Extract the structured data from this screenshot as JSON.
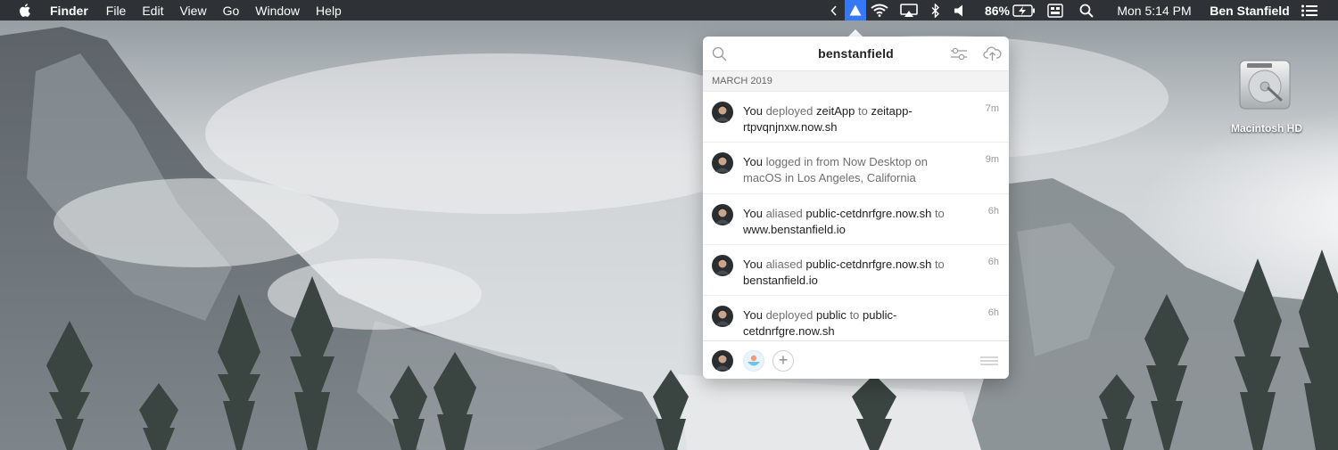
{
  "menubar": {
    "app_name": "Finder",
    "menus": [
      "File",
      "Edit",
      "View",
      "Go",
      "Window",
      "Help"
    ],
    "battery": "86%",
    "clock": "Mon 5:14 PM",
    "user": "Ben Stanfield",
    "icons": [
      "apple-icon",
      "chevron-left-icon",
      "now-triangle-icon",
      "wifi-icon",
      "airplay-icon",
      "bluetooth-icon",
      "volume-icon",
      "battery-charging-icon",
      "input-menu-icon",
      "spotlight-search-icon",
      "notification-center-icon"
    ],
    "active_color": "#3478f6"
  },
  "desktop": {
    "drive_label": "Macintosh HD"
  },
  "popover": {
    "title": "benstanfield",
    "section": "MARCH 2019",
    "events": [
      {
        "actor": "You",
        "verb": "deployed",
        "object": "zeitApp",
        "prep": "to",
        "target": "zeitapp-rtpvqnjnxw.now.sh",
        "time": "7m"
      },
      {
        "actor": "You",
        "verb": "logged in from",
        "object": "Now Desktop on macOS",
        "prep": "in",
        "target": "Los Angeles, California",
        "time": "9m"
      },
      {
        "actor": "You",
        "verb": "aliased",
        "object": "public-cetdnrfgre.now.sh",
        "prep": "to",
        "target": "www.benstanfield.io",
        "time": "6h"
      },
      {
        "actor": "You",
        "verb": "aliased",
        "object": "public-cetdnrfgre.now.sh",
        "prep": "to",
        "target": "benstanfield.io",
        "time": "6h"
      },
      {
        "actor": "You",
        "verb": "deployed",
        "object": "public",
        "prep": "to",
        "target": "public-cetdnrfgre.now.sh",
        "time": "6h"
      }
    ],
    "footer": {
      "add_label": "+"
    }
  }
}
